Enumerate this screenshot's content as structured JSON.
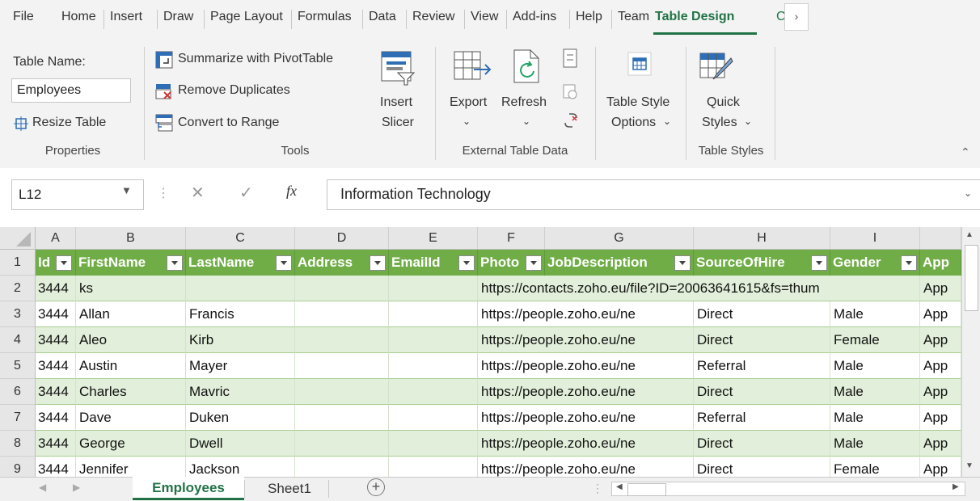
{
  "ribbon_tabs": [
    "File",
    "Home",
    "Insert",
    "Draw",
    "Page Layout",
    "Formulas",
    "Data",
    "Review",
    "View",
    "Add-ins",
    "Help",
    "Team",
    "Table Design",
    "C"
  ],
  "ribbon": {
    "table_name_label": "Table Name:",
    "table_name_value": "Employees",
    "resize_table": "Resize Table",
    "properties_group": "Properties",
    "summarize_pivot": "Summarize with PivotTable",
    "remove_duplicates": "Remove Duplicates",
    "convert_to_range": "Convert to Range",
    "tools_group": "Tools",
    "insert_slicer_line1": "Insert",
    "insert_slicer_line2": "Slicer",
    "export_label": "Export",
    "refresh_label": "Refresh",
    "external_group": "External Table Data",
    "table_style_options_line1": "Table Style",
    "table_style_options_line2": "Options",
    "quick_styles_line1": "Quick",
    "quick_styles_line2": "Styles",
    "table_styles_group": "Table Styles"
  },
  "formula_bar": {
    "name_box": "L12",
    "fx": "fx",
    "value": "Information Technology"
  },
  "columns": [
    "A",
    "B",
    "C",
    "D",
    "E",
    "F",
    "G",
    "H",
    "I"
  ],
  "header_row_number": "1",
  "table_headers": [
    "Id",
    "FirstName",
    "LastName",
    "Address",
    "EmailId",
    "Photo",
    "JobDescription",
    "SourceOfHire",
    "Gender",
    "App"
  ],
  "rows": [
    {
      "num": "2",
      "cells": [
        "3444",
        "ks",
        "",
        "",
        "",
        "https://contacts.zoho.eu/file?ID=20063641615&fs=thum",
        "",
        "",
        "App"
      ]
    },
    {
      "num": "3",
      "cells": [
        "3444",
        "Allan",
        "Francis",
        "",
        "",
        "https://people.zoho.eu/ne",
        "Direct",
        "Male",
        "App"
      ]
    },
    {
      "num": "4",
      "cells": [
        "3444",
        "Aleo",
        "Kirb",
        "",
        "",
        "https://people.zoho.eu/ne",
        "Direct",
        "Female",
        "App"
      ]
    },
    {
      "num": "5",
      "cells": [
        "3444",
        "Austin",
        "Mayer",
        "",
        "",
        "https://people.zoho.eu/ne",
        "Referral",
        "Male",
        "App"
      ]
    },
    {
      "num": "6",
      "cells": [
        "3444",
        "Charles",
        "Mavric",
        "",
        "",
        "https://people.zoho.eu/ne",
        "Direct",
        "Male",
        "App"
      ]
    },
    {
      "num": "7",
      "cells": [
        "3444",
        "Dave",
        "Duken",
        "",
        "",
        "https://people.zoho.eu/ne",
        "Referral",
        "Male",
        "App"
      ]
    },
    {
      "num": "8",
      "cells": [
        "3444",
        "George",
        "Dwell",
        "",
        "",
        "https://people.zoho.eu/ne",
        "Direct",
        "Male",
        "App"
      ]
    },
    {
      "num": "9",
      "cells": [
        "3444",
        "Jennifer",
        "Jackson",
        "",
        "",
        "https://people.zoho.eu/ne",
        "Direct",
        "Female",
        "App"
      ]
    }
  ],
  "sheets": {
    "active": "Employees",
    "other": "Sheet1"
  },
  "colors": {
    "accent": "#217346",
    "table_header": "#70ad47",
    "band": "#e2efda"
  }
}
